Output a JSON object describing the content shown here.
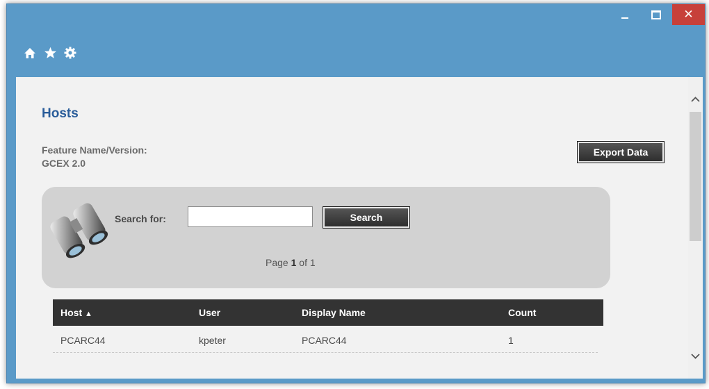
{
  "window": {
    "controls": {
      "minimize_icon": "minimize-icon",
      "maximize_icon": "maximize-icon",
      "close_glyph": "✕"
    }
  },
  "toolbar": {
    "icons": [
      "home-icon",
      "star-icon",
      "gear-icon"
    ]
  },
  "page": {
    "title": "Hosts",
    "feature_label": "Feature Name/Version:",
    "feature_value": "GCEX 2.0",
    "export_label": "Export Data"
  },
  "search": {
    "label": "Search for:",
    "value": "",
    "placeholder": "",
    "button_label": "Search",
    "icon": "binoculars-icon"
  },
  "pagination": {
    "prefix": "Page",
    "current": "1",
    "separator": "of",
    "total": "1"
  },
  "table": {
    "columns": [
      "Host",
      "User",
      "Display Name",
      "Count"
    ],
    "sort_indicator": "▲",
    "rows": [
      {
        "host": "PCARC44",
        "user": "kpeter",
        "display_name": "PCARC44",
        "count": "1"
      }
    ]
  },
  "colors": {
    "titlebar": "#5a9ac8",
    "close_button": "#c7403a",
    "title_text": "#2a5d9a",
    "table_header": "#333333",
    "panel": "#d2d2d2"
  }
}
